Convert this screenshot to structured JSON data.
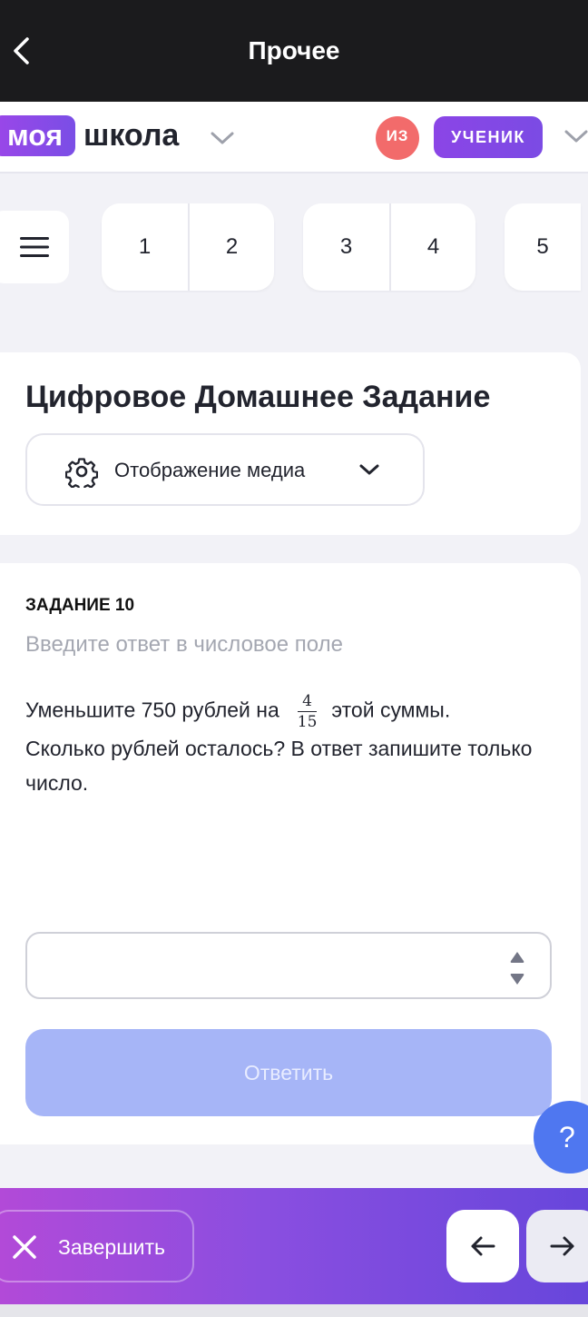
{
  "topbar": {
    "title": "Прочее",
    "back_icon": "chevron-left-icon"
  },
  "brand": {
    "logo_part1": "моя",
    "logo_part2": "школа",
    "avatar_initials": "ИЗ",
    "role_label": "УЧЕНИК"
  },
  "tabs": {
    "menu_icon": "hamburger-icon",
    "items": [
      "1",
      "2",
      "3",
      "4",
      "5"
    ]
  },
  "homework": {
    "title": "Цифровое Домашнее Задание",
    "media_label": "Отображение медиа",
    "media_icon": "gear-icon"
  },
  "task": {
    "label": "ЗАДАНИЕ 10",
    "hint": "Введите ответ в числовое поле",
    "question_part1": "Уменьшите 750 рублей на",
    "fraction_num": "4",
    "fraction_den": "15",
    "question_part2": "этой суммы. Сколько рублей осталось? В ответ запишите только число.",
    "answer_value": "",
    "submit_label": "Ответить"
  },
  "help": {
    "label": "?"
  },
  "bottom": {
    "finish_label": "Завершить"
  },
  "colors": {
    "accent": "#7b4be4",
    "avatar": "#f26b6b",
    "submit_disabled": "#a6b5f7",
    "help": "#4f77f0"
  }
}
